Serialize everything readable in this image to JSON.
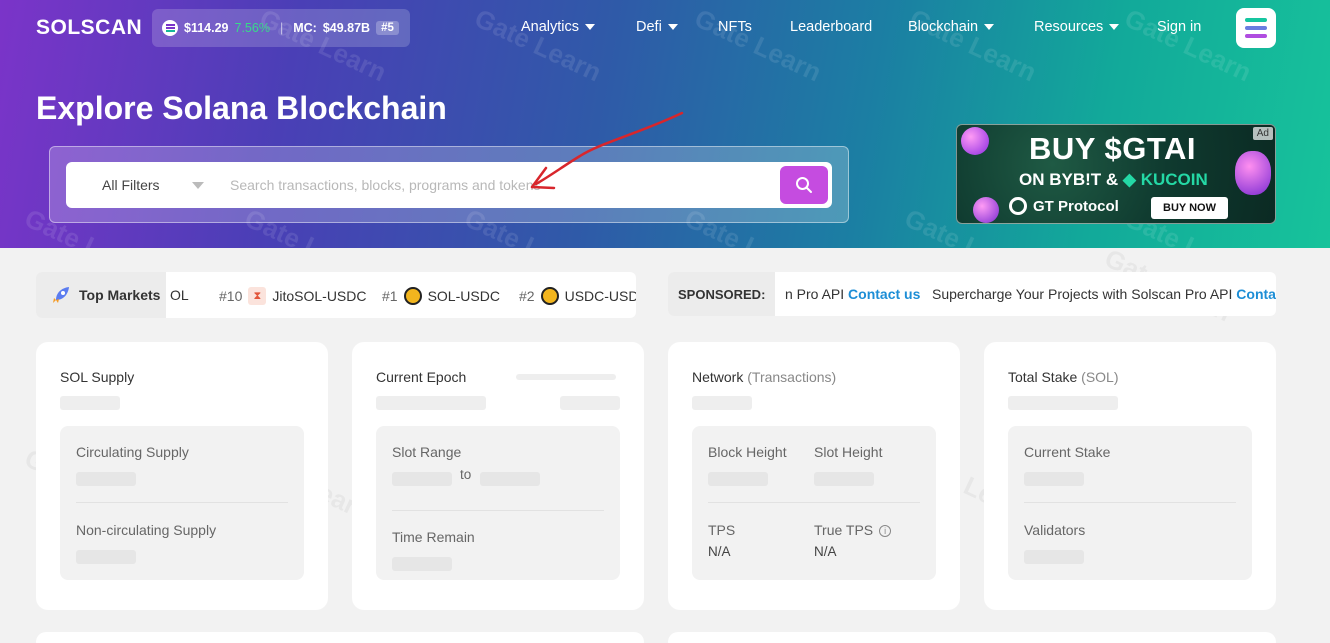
{
  "header": {
    "logo": "SOLSCAN",
    "price": "$114.29",
    "change": "7.56%",
    "mc_label": "MC:",
    "mc_value": "$49.87B",
    "rank": "#5",
    "nav": [
      "Analytics",
      "Defi",
      "NFTs",
      "Leaderboard",
      "Blockchain",
      "Resources",
      "Sign in"
    ]
  },
  "hero": {
    "title": "Explore Solana Blockchain",
    "filter_label": "All Filters",
    "search_placeholder": "Search transactions, blocks, programs and tokens"
  },
  "ad": {
    "tag": "Ad",
    "line1": "BUY $GTAI",
    "line2_a": "ON BYB!T &",
    "line2_b": "KUCOIN",
    "brand": "GT Protocol",
    "cta": "BUY NOW"
  },
  "ticker": {
    "label": "Top Markets",
    "items": [
      {
        "rank": "",
        "pair": "OL"
      },
      {
        "rank": "#10",
        "pair": "JitoSOL-USDC"
      },
      {
        "rank": "#1",
        "pair": "SOL-USDC"
      },
      {
        "rank": "#2",
        "pair": "USDC-USDT"
      }
    ]
  },
  "sponsored": {
    "label": "SPONSORED:",
    "items": [
      {
        "text": "n Pro API",
        "link": "Contact us"
      },
      {
        "text": "Supercharge Your Projects with Solscan Pro API",
        "link": "Conta"
      }
    ]
  },
  "cards": {
    "supply": {
      "title": "SOL Supply",
      "circulating": "Circulating Supply",
      "non_circulating": "Non-circulating Supply"
    },
    "epoch": {
      "title": "Current Epoch",
      "slot_range": "Slot Range",
      "to": "to",
      "time_remain": "Time Remain"
    },
    "network": {
      "title": "Network",
      "title_muted": "(Transactions)",
      "block_height": "Block Height",
      "slot_height": "Slot Height",
      "tps": "TPS",
      "true_tps": "True TPS",
      "tps_value": "N/A",
      "true_tps_value": "N/A"
    },
    "stake": {
      "title": "Total Stake",
      "title_muted": "(SOL)",
      "current_stake": "Current Stake",
      "validators": "Validators"
    }
  },
  "watermark": "Gate Learn",
  "colors": {
    "accent": "#c54ce0",
    "link": "#1d8ed6",
    "positive": "#39d98a"
  }
}
